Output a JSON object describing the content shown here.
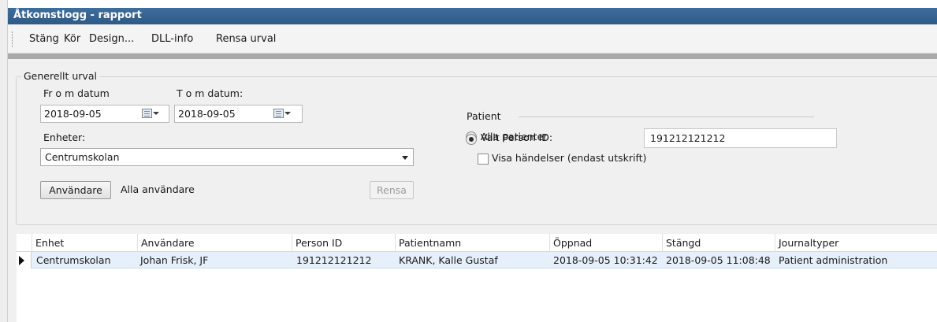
{
  "window": {
    "title": "Åtkomstlogg - rapport"
  },
  "menu": {
    "items": [
      {
        "label": "Stäng"
      },
      {
        "label": "Kör"
      },
      {
        "label": "Design..."
      },
      {
        "label": "DLL-info"
      },
      {
        "label": "Rensa urval"
      }
    ]
  },
  "filter": {
    "group_label": "Generellt urval",
    "from_date_label": "Fr o m datum",
    "from_date_value": "2018-09-05",
    "to_date_label": "T o m datum:",
    "to_date_value": "2018-09-05",
    "units_label": "Enheter:",
    "units_value": "Centrumskolan",
    "users_button": "Användare",
    "users_value": "Alla användare",
    "clear_button": "Rensa"
  },
  "patient": {
    "group_label": "Patient",
    "all_patients_label": "Alla patienter",
    "all_patients_selected": false,
    "selected_person_label": "Valt Person ID:",
    "selected_person_selected": true,
    "person_id_value": "191212121212",
    "show_events_label": "Visa händelser (endast utskrift)",
    "show_events_checked": false
  },
  "table": {
    "columns": [
      "Enhet",
      "Användare",
      "Person ID",
      "Patientnamn",
      "Öppnad",
      "Stängd",
      "Journaltyper"
    ],
    "rows": [
      {
        "enhet": "Centrumskolan",
        "anvandare": "Johan Frisk, JF",
        "person_id": "191212121212",
        "patientnamn": "KRANK, Kalle Gustaf",
        "oppnad": "2018-09-05 10:31:42",
        "stangd": "2018-09-05 11:08:48",
        "journaltyper": "Patient administration"
      }
    ]
  }
}
